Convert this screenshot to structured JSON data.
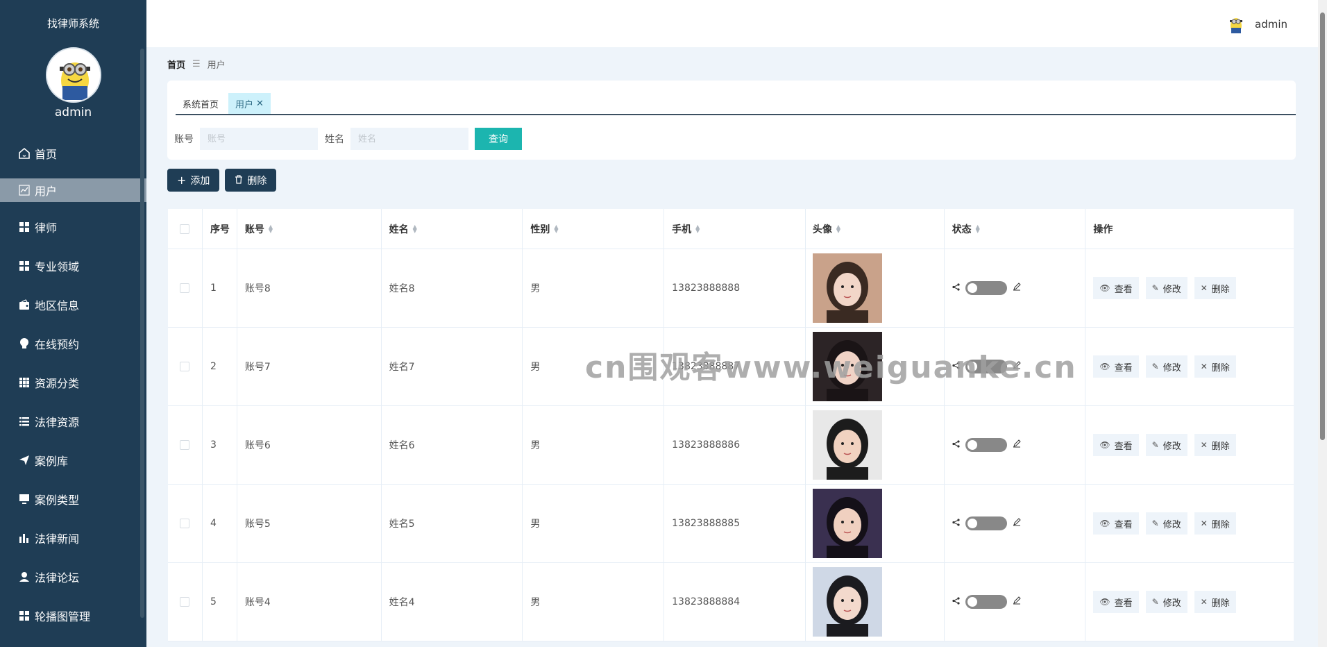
{
  "app": {
    "title": "找律师系统",
    "user": "admin"
  },
  "sidebar": {
    "items": [
      {
        "label": "首页",
        "icon": "home-icon"
      },
      {
        "label": "用户",
        "icon": "chart-line-icon",
        "active": true
      },
      {
        "label": "律师",
        "icon": "grid-icon"
      },
      {
        "label": "专业领域",
        "icon": "grid-icon"
      },
      {
        "label": "地区信息",
        "icon": "wallet-icon"
      },
      {
        "label": "在线预约",
        "icon": "bulb-icon"
      },
      {
        "label": "资源分类",
        "icon": "apps-icon"
      },
      {
        "label": "法律资源",
        "icon": "list-icon"
      },
      {
        "label": "案例库",
        "icon": "send-icon"
      },
      {
        "label": "案例类型",
        "icon": "monitor-icon"
      },
      {
        "label": "法律新闻",
        "icon": "bar-chart-icon"
      },
      {
        "label": "法律论坛",
        "icon": "person-icon"
      },
      {
        "label": "轮播图管理",
        "icon": "grid-icon"
      }
    ]
  },
  "breadcrumb": {
    "home": "首页",
    "separator": "☰",
    "current": "用户"
  },
  "tabs": [
    {
      "label": "系统首页"
    },
    {
      "label": "用户",
      "active": true,
      "close": "✕"
    }
  ],
  "search": {
    "account_label": "账号",
    "account_placeholder": "账号",
    "name_label": "姓名",
    "name_placeholder": "姓名",
    "query_label": "查询"
  },
  "toolbar": {
    "add_label": "添加",
    "delete_label": "删除"
  },
  "table": {
    "columns": [
      "序号",
      "账号",
      "姓名",
      "性别",
      "手机",
      "头像",
      "状态",
      "操作"
    ],
    "rows": [
      {
        "index": "1",
        "account": "账号8",
        "name": "姓名8",
        "gender": "男",
        "phone": "13823888888"
      },
      {
        "index": "2",
        "account": "账号7",
        "name": "姓名7",
        "gender": "男",
        "phone": "13823888887"
      },
      {
        "index": "3",
        "account": "账号6",
        "name": "姓名6",
        "gender": "男",
        "phone": "13823888886"
      },
      {
        "index": "4",
        "account": "账号5",
        "name": "姓名5",
        "gender": "男",
        "phone": "13823888885"
      },
      {
        "index": "5",
        "account": "账号4",
        "name": "姓名4",
        "gender": "男",
        "phone": "13823888884"
      }
    ],
    "row_actions": {
      "view": "查看",
      "edit": "修改",
      "delete": "删除"
    }
  },
  "watermark": "cn围观客www.weiguanke.cn",
  "colors": {
    "sidebar_bg": "#1f3d55",
    "accent": "#1cb5af",
    "active_tab": "#cdf1fb",
    "content_bg": "#eef4fa"
  }
}
